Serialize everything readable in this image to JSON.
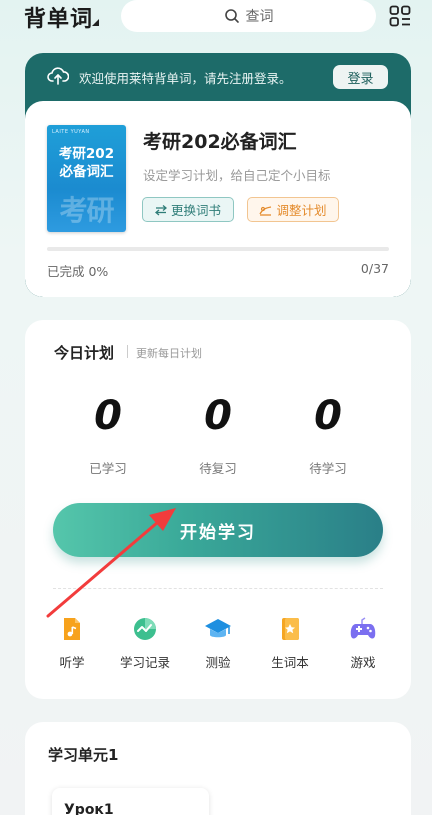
{
  "header": {
    "title": "背单词",
    "search_placeholder": "查词"
  },
  "banner": {
    "text": "欢迎使用莱特背单词，请先注册登录。",
    "login_label": "登录"
  },
  "book": {
    "cover_brand": "LAITE YUYAN",
    "cover_title_line1": "考研202",
    "cover_title_line2": "必备词汇",
    "cover_watermark": "考研",
    "title": "考研202必备词汇",
    "subtitle": "设定学习计划，给自己定个小目标",
    "change_book_label": "更换词书",
    "adjust_plan_label": "调整计划",
    "progress_label": "已完成 0%",
    "progress_count": "0/37",
    "progress_fraction": 0
  },
  "plan": {
    "title": "今日计划",
    "update_link": "更新每日计划",
    "stats": [
      {
        "value": "0",
        "label": "已学习"
      },
      {
        "value": "0",
        "label": "待复习"
      },
      {
        "value": "0",
        "label": "待学习"
      }
    ],
    "start_label": "开始学习",
    "tools": [
      {
        "label": "听学",
        "icon": "listen-icon"
      },
      {
        "label": "学习记录",
        "icon": "record-icon"
      },
      {
        "label": "测验",
        "icon": "quiz-icon"
      },
      {
        "label": "生词本",
        "icon": "notebook-icon"
      },
      {
        "label": "游戏",
        "icon": "game-icon"
      }
    ]
  },
  "unit": {
    "title": "学习单元1",
    "lesson_title": "Урок1"
  },
  "colors": {
    "accent": "#2a8c86",
    "banner": "#1d6b69",
    "annotation_arrow": "#f23c3c"
  }
}
